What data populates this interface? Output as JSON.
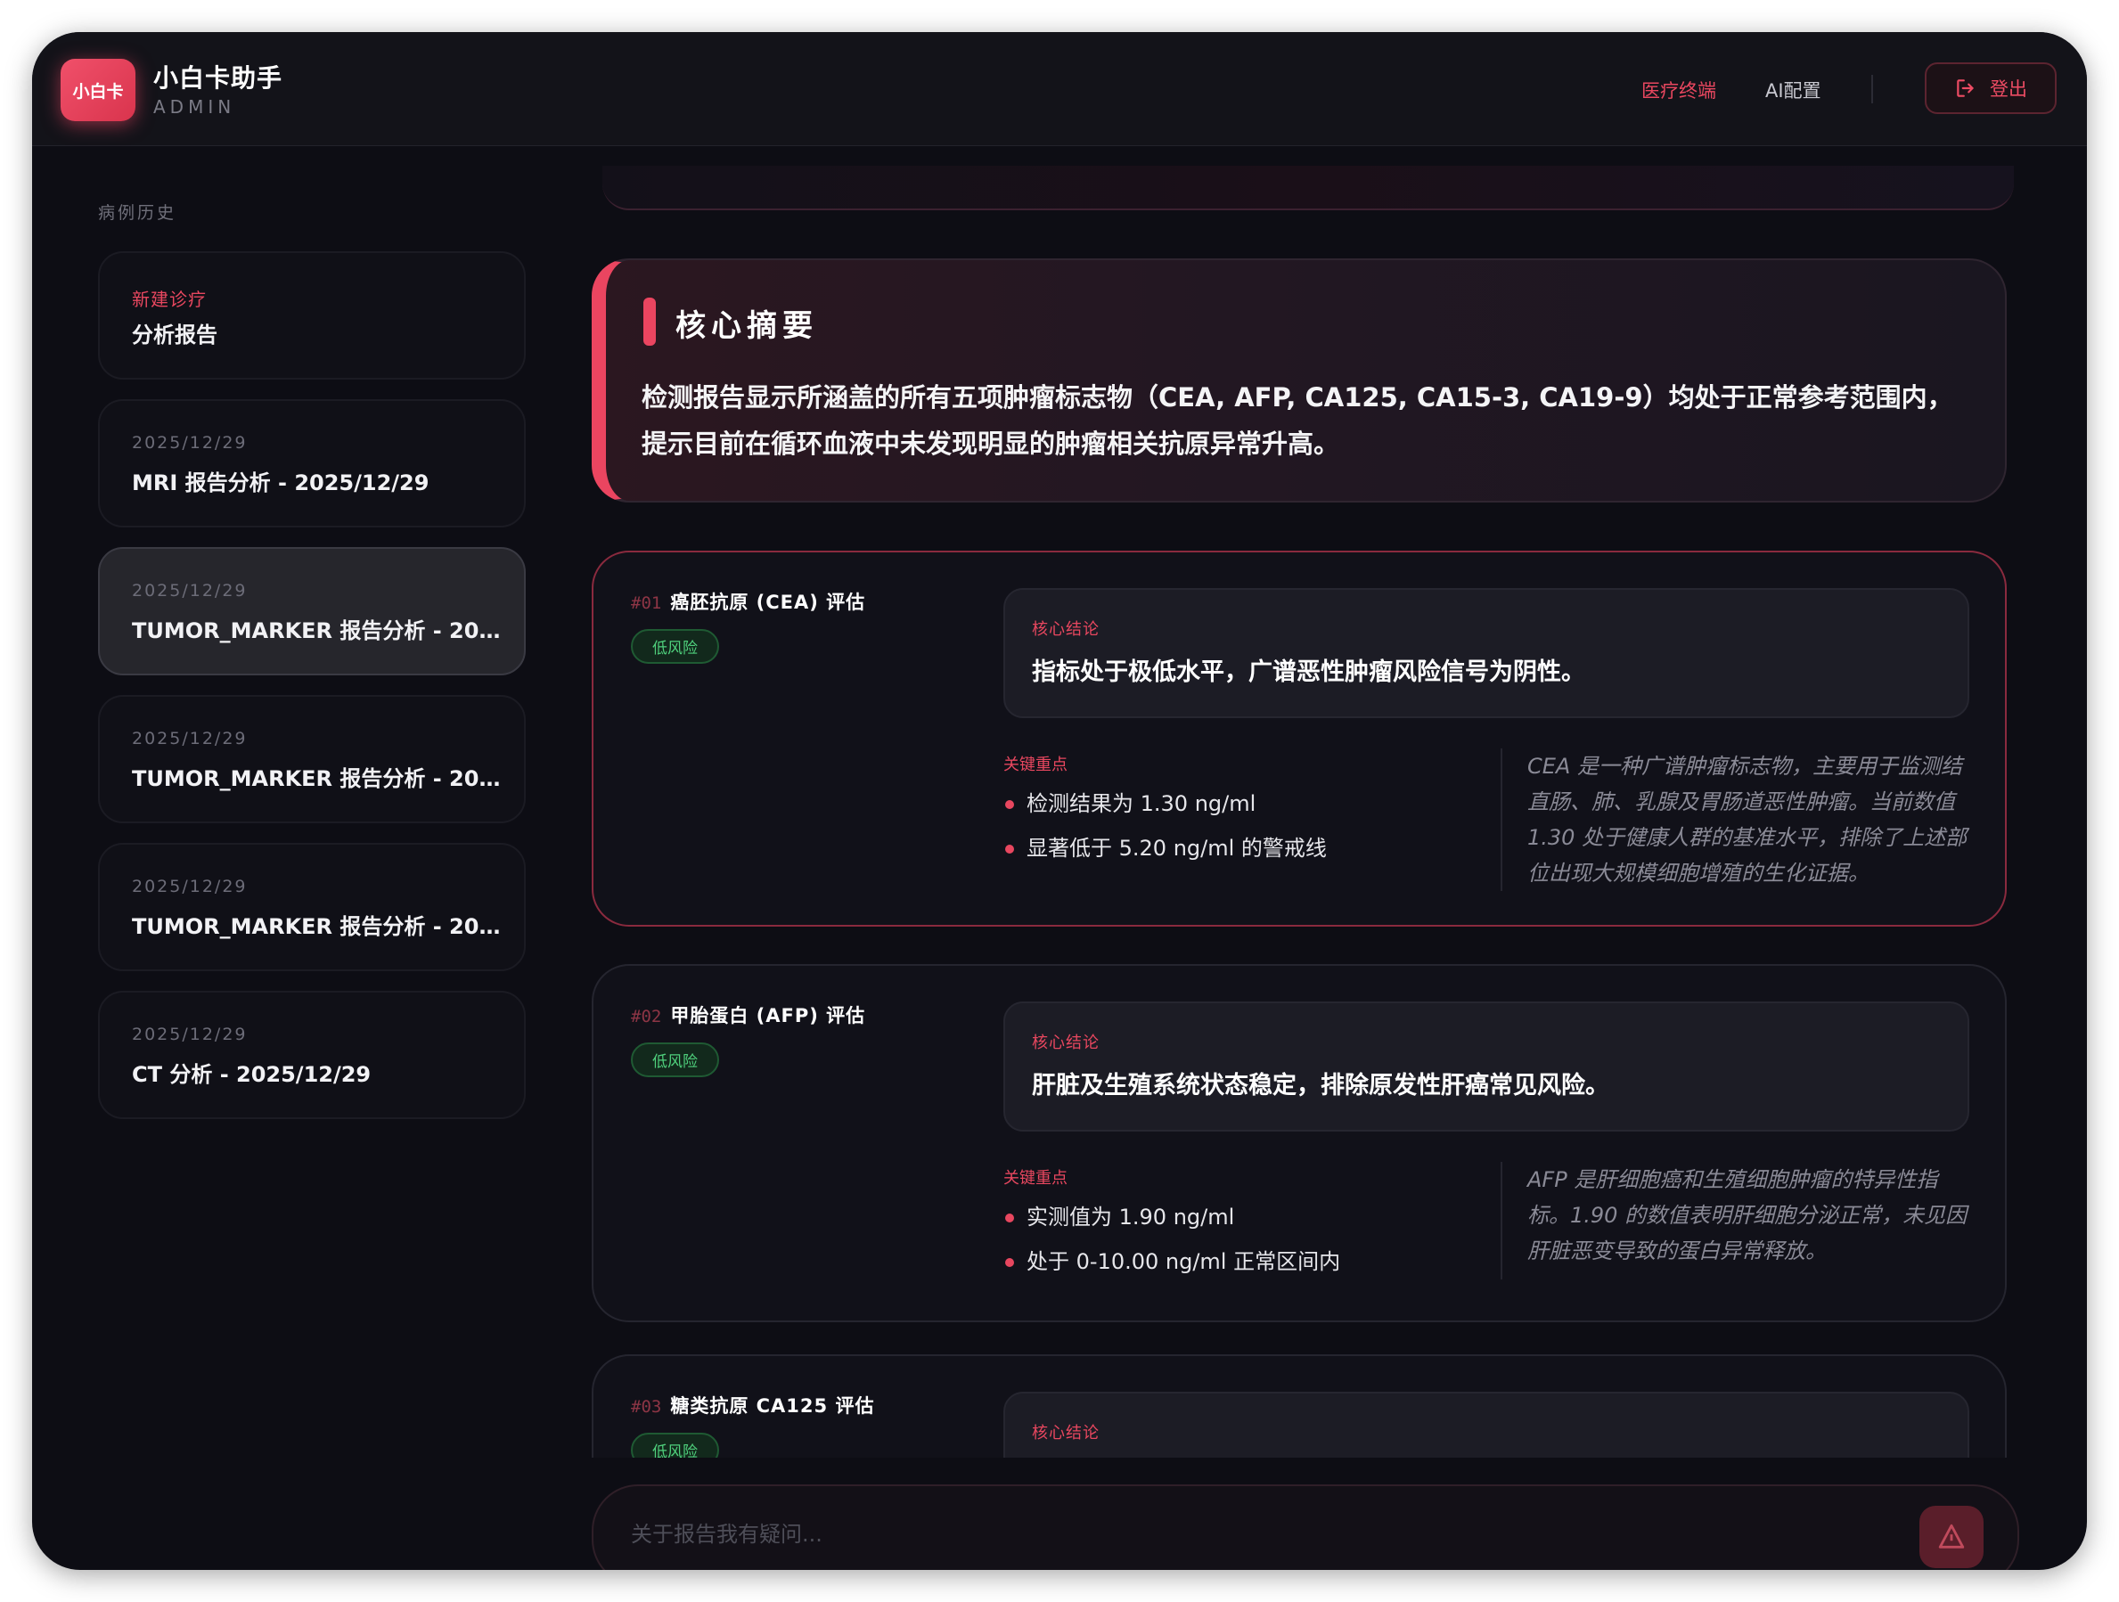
{
  "header": {
    "logo_text": "小白卡",
    "app_name": "小白卡助手",
    "app_sub": "ADMIN",
    "nav": [
      "医疗终端",
      "AI配置"
    ],
    "logout_label": "登出"
  },
  "sidebar": {
    "title": "病例历史",
    "cases": [
      {
        "date": "新建诊疗",
        "title": "分析报告",
        "is_new": true
      },
      {
        "date": "2025/12/29",
        "title": "MRI 报告分析 - 2025/12/29"
      },
      {
        "date": "2025/12/29",
        "title": "TUMOR_MARKER 报告分析 - 202...",
        "active": true
      },
      {
        "date": "2025/12/29",
        "title": "TUMOR_MARKER 报告分析 - 202..."
      },
      {
        "date": "2025/12/29",
        "title": "TUMOR_MARKER 报告分析 - 202..."
      },
      {
        "date": "2025/12/29",
        "title": "CT 分析 - 2025/12/29"
      }
    ]
  },
  "summary": {
    "title": "核心摘要",
    "text": "检测报告显示所涵盖的所有五项肿瘤标志物（CEA, AFP, CA125, CA15-3, CA19-9）均处于正常参考范围内，提示目前在循环血液中未发现明显的肿瘤相关抗原异常升高。"
  },
  "markers": [
    {
      "num": "#01",
      "name": "癌胚抗原 (CEA) 评估",
      "risk": "低风险",
      "conclusion_label": "核心结论",
      "conclusion": "指标处于极低水平，广谱恶性肿瘤风险信号为阴性。",
      "keypoints_label": "关键重点",
      "keypoints": [
        "检测结果为 1.30 ng/ml",
        "显著低于 5.20 ng/ml 的警戒线"
      ],
      "note": "CEA 是一种广谱肿瘤标志物，主要用于监测结直肠、肺、乳腺及胃肠道恶性肿瘤。当前数值 1.30 处于健康人群的基准水平，排除了上述部位出现大规模细胞增殖的生化证据。"
    },
    {
      "num": "#02",
      "name": "甲胎蛋白 (AFP) 评估",
      "risk": "低风险",
      "conclusion_label": "核心结论",
      "conclusion": "肝脏及生殖系统状态稳定，排除原发性肝癌常见风险。",
      "keypoints_label": "关键重点",
      "keypoints": [
        "实测值为 1.90 ng/ml",
        "处于 0-10.00 ng/ml 正常区间内"
      ],
      "note": "AFP 是肝细胞癌和生殖细胞肿瘤的特异性指标。1.90 的数值表明肝细胞分泌正常，未见因肝脏恶变导致的蛋白异常释放。"
    },
    {
      "num": "#03",
      "name": "糖类抗原 CA125 评估",
      "risk": "低风险",
      "conclusion_label": "核心结论"
    }
  ],
  "chat": {
    "placeholder": "关于报告我有疑问..."
  },
  "colors": {
    "accent": "#e8475f",
    "risk_low": "#4fd07c",
    "background": "#0d0d14"
  }
}
